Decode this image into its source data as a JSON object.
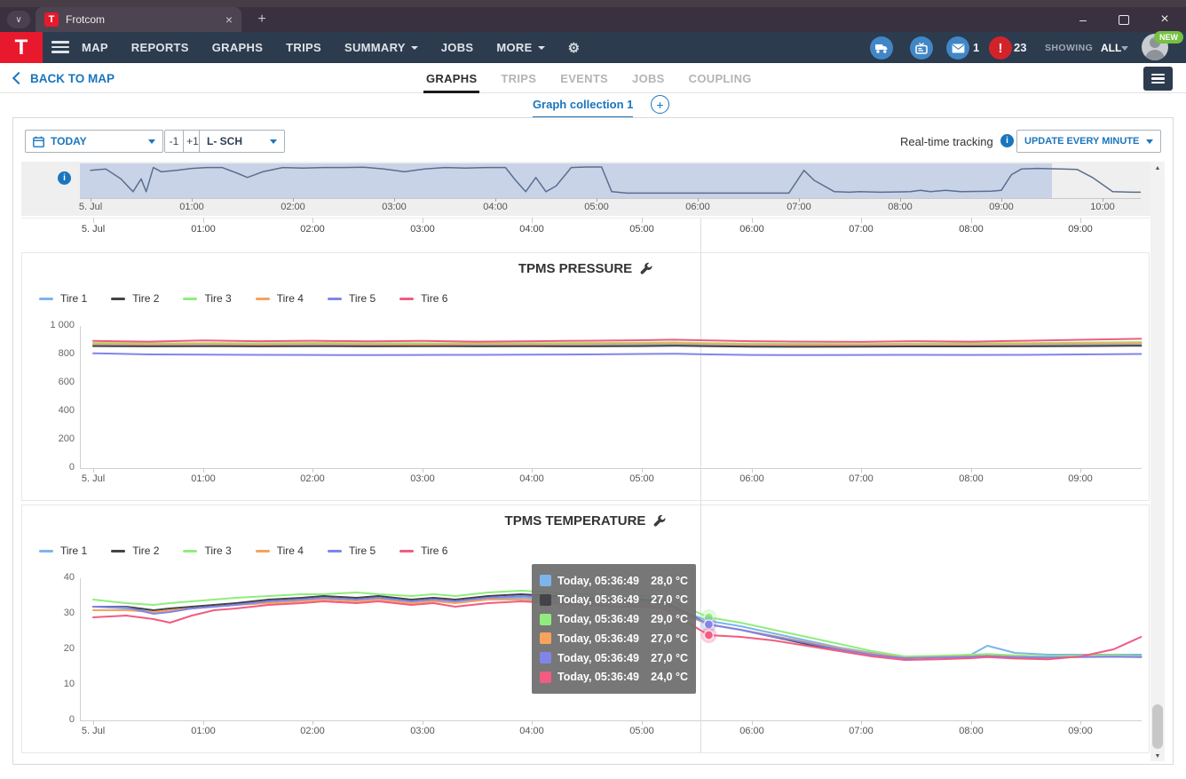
{
  "browser": {
    "tab_title": "Frotcom",
    "brand_letter": "T"
  },
  "navbar": {
    "items": [
      {
        "label": "MAP",
        "caret": false
      },
      {
        "label": "REPORTS",
        "caret": false
      },
      {
        "label": "GRAPHS",
        "caret": false
      },
      {
        "label": "TRIPS",
        "caret": false
      },
      {
        "label": "SUMMARY",
        "caret": true
      },
      {
        "label": "JOBS",
        "caret": false
      },
      {
        "label": "MORE",
        "caret": true
      }
    ],
    "mail_count": "1",
    "alert_count": "23",
    "showing_label": "SHOWING",
    "showing_value": "ALL",
    "new_badge": "NEW"
  },
  "subnav": {
    "back_label": "BACK TO MAP",
    "tabs": [
      {
        "label": "GRAPHS",
        "active": true
      },
      {
        "label": "TRIPS",
        "active": false
      },
      {
        "label": "EVENTS",
        "active": false
      },
      {
        "label": "JOBS",
        "active": false
      },
      {
        "label": "COUPLING",
        "active": false
      }
    ]
  },
  "collection": {
    "tab_label": "Graph collection 1"
  },
  "filters": {
    "date_range": "TODAY",
    "prev_label": "-1",
    "next_label": "+1",
    "vehicle": "L- SCH",
    "realtime_label": "Real-time tracking",
    "update_mode": "UPDATE EVERY MINUTE"
  },
  "icons": {
    "tab_search": "chevron-down",
    "favicon": "frotcom-logo",
    "nav_left": "hamburger",
    "nav_right": [
      "delivery-truck",
      "tv",
      "envelope",
      "exclamation-alert"
    ],
    "settings": "gear",
    "date": "calendar",
    "chart_settings": "wrench",
    "overview": "info",
    "collection_add": "plus",
    "panel_right": "list"
  },
  "colors": {
    "accent_blue": "#1b75bc",
    "brand_red": "#e8192c",
    "navbar_bg": "#2d3b4e",
    "icon_blue": "#4187c7",
    "alert_red": "#d2232a",
    "new_green": "#76c043",
    "series_palette": [
      "#7cb5ec",
      "#434348",
      "#90ed7d",
      "#f7a35c",
      "#8085e9",
      "#f15c80"
    ]
  },
  "chart_data": [
    {
      "type": "area",
      "name": "activity-overview-navigator",
      "x_unit": "hours since midnight, 5. Jul",
      "xlim": [
        -0.1,
        10.45
      ],
      "selection": [
        0,
        9.5
      ],
      "line_color": "#5b6e8e",
      "selection_color": "rgba(125,155,215,0.33)",
      "x_labels": [
        {
          "t": 0,
          "label": "5. Jul"
        },
        {
          "t": 1,
          "label": "01:00"
        },
        {
          "t": 2,
          "label": "02:00"
        },
        {
          "t": 3,
          "label": "03:00"
        },
        {
          "t": 4,
          "label": "04:00"
        },
        {
          "t": 5,
          "label": "05:00"
        },
        {
          "t": 6,
          "label": "06:00"
        },
        {
          "t": 7,
          "label": "07:00"
        },
        {
          "t": 8,
          "label": "08:00"
        },
        {
          "t": 9,
          "label": "09:00"
        },
        {
          "t": 10,
          "label": "10:00"
        }
      ],
      "points": [
        [
          0,
          0.85
        ],
        [
          0.15,
          0.9
        ],
        [
          0.3,
          0.55
        ],
        [
          0.42,
          0.1
        ],
        [
          0.5,
          0.55
        ],
        [
          0.55,
          0.1
        ],
        [
          0.62,
          0.95
        ],
        [
          0.7,
          0.8
        ],
        [
          0.85,
          0.85
        ],
        [
          1.0,
          0.92
        ],
        [
          1.15,
          0.95
        ],
        [
          1.3,
          0.95
        ],
        [
          1.45,
          0.75
        ],
        [
          1.55,
          0.6
        ],
        [
          1.7,
          0.8
        ],
        [
          1.9,
          0.95
        ],
        [
          2.1,
          0.93
        ],
        [
          2.3,
          0.95
        ],
        [
          2.5,
          0.95
        ],
        [
          2.7,
          0.96
        ],
        [
          2.9,
          0.9
        ],
        [
          3.0,
          0.85
        ],
        [
          3.1,
          0.8
        ],
        [
          3.3,
          0.9
        ],
        [
          3.5,
          0.95
        ],
        [
          3.7,
          0.93
        ],
        [
          3.9,
          0.95
        ],
        [
          4.1,
          0.95
        ],
        [
          4.2,
          0.5
        ],
        [
          4.3,
          0.1
        ],
        [
          4.4,
          0.6
        ],
        [
          4.5,
          0.1
        ],
        [
          4.6,
          0.3
        ],
        [
          4.75,
          0.95
        ],
        [
          4.9,
          0.97
        ],
        [
          5.05,
          0.97
        ],
        [
          5.15,
          0.1
        ],
        [
          5.3,
          0.05
        ],
        [
          6.0,
          0.05
        ],
        [
          6.9,
          0.05
        ],
        [
          7.05,
          0.85
        ],
        [
          7.15,
          0.5
        ],
        [
          7.35,
          0.1
        ],
        [
          7.5,
          0.08
        ],
        [
          7.6,
          0.1
        ],
        [
          7.8,
          0.08
        ],
        [
          8.1,
          0.1
        ],
        [
          8.2,
          0.15
        ],
        [
          8.3,
          0.1
        ],
        [
          8.45,
          0.15
        ],
        [
          8.6,
          0.1
        ],
        [
          8.9,
          0.12
        ],
        [
          9.0,
          0.15
        ],
        [
          9.1,
          0.7
        ],
        [
          9.2,
          0.9
        ],
        [
          9.35,
          0.92
        ],
        [
          9.6,
          0.9
        ],
        [
          9.75,
          0.88
        ],
        [
          9.9,
          0.6
        ],
        [
          10.1,
          0.1
        ],
        [
          10.3,
          0.08
        ],
        [
          10.45,
          0.08
        ]
      ]
    },
    {
      "type": "line",
      "title": "TPMS PRESSURE",
      "ylim": [
        0,
        1000
      ],
      "yticks": [
        {
          "v": 0,
          "label": "0"
        },
        {
          "v": 200,
          "label": "200"
        },
        {
          "v": 400,
          "label": "400"
        },
        {
          "v": 600,
          "label": "600"
        },
        {
          "v": 800,
          "label": "800"
        },
        {
          "v": 1000,
          "label": "1 000"
        }
      ],
      "x_labels": [
        {
          "t": 0,
          "label": "5. Jul"
        },
        {
          "t": 1,
          "label": "01:00"
        },
        {
          "t": 2,
          "label": "02:00"
        },
        {
          "t": 3,
          "label": "03:00"
        },
        {
          "t": 4,
          "label": "04:00"
        },
        {
          "t": 5,
          "label": "05:00"
        },
        {
          "t": 6,
          "label": "06:00"
        },
        {
          "t": 7,
          "label": "07:00"
        },
        {
          "t": 8,
          "label": "08:00"
        },
        {
          "t": 9,
          "label": "09:00"
        }
      ],
      "x": [
        0,
        0.5,
        1,
        1.5,
        2,
        2.5,
        3,
        3.5,
        4,
        4.5,
        5,
        5.3,
        5.61,
        6,
        6.5,
        7,
        7.5,
        8,
        8.5,
        9,
        9.55
      ],
      "series": [
        {
          "name": "Tire 1",
          "color": "#7cb5ec",
          "values": [
            868,
            864,
            866,
            865,
            867,
            864,
            866,
            865,
            864,
            866,
            868,
            870,
            866,
            862,
            861,
            862,
            863,
            864,
            865,
            868,
            872
          ]
        },
        {
          "name": "Tire 2",
          "color": "#434348",
          "values": [
            859,
            857,
            858,
            857,
            858,
            857,
            858,
            857,
            858,
            857,
            859,
            861,
            858,
            855,
            854,
            855,
            856,
            856,
            857,
            859,
            861
          ]
        },
        {
          "name": "Tire 3",
          "color": "#90ed7d",
          "values": [
            882,
            878,
            880,
            879,
            881,
            880,
            879,
            878,
            880,
            881,
            883,
            885,
            880,
            876,
            875,
            874,
            876,
            878,
            880,
            884,
            887
          ]
        },
        {
          "name": "Tire 4",
          "color": "#f7a35c",
          "values": [
            874,
            872,
            874,
            871,
            873,
            872,
            871,
            873,
            872,
            874,
            876,
            878,
            874,
            870,
            869,
            870,
            871,
            872,
            873,
            876,
            879
          ]
        },
        {
          "name": "Tire 5",
          "color": "#8085e9",
          "values": [
            808,
            800,
            798,
            797,
            796,
            795,
            796,
            797,
            798,
            800,
            803,
            805,
            800,
            796,
            795,
            796,
            797,
            796,
            797,
            800,
            803
          ]
        },
        {
          "name": "Tire 6",
          "color": "#f15c80",
          "values": [
            895,
            890,
            898,
            893,
            896,
            892,
            895,
            890,
            893,
            896,
            900,
            904,
            898,
            893,
            890,
            888,
            893,
            890,
            896,
            903,
            910
          ]
        }
      ]
    },
    {
      "type": "line",
      "title": "TPMS TEMPERATURE",
      "ylim": [
        0,
        40
      ],
      "yticks": [
        {
          "v": 0,
          "label": "0"
        },
        {
          "v": 10,
          "label": "10"
        },
        {
          "v": 20,
          "label": "20"
        },
        {
          "v": 30,
          "label": "30"
        },
        {
          "v": 40,
          "label": "40"
        }
      ],
      "x_labels": [
        {
          "t": 0,
          "label": "5. Jul"
        },
        {
          "t": 1,
          "label": "01:00"
        },
        {
          "t": 2,
          "label": "02:00"
        },
        {
          "t": 3,
          "label": "03:00"
        },
        {
          "t": 4,
          "label": "04:00"
        },
        {
          "t": 5,
          "label": "05:00"
        },
        {
          "t": 6,
          "label": "06:00"
        },
        {
          "t": 7,
          "label": "07:00"
        },
        {
          "t": 8,
          "label": "08:00"
        },
        {
          "t": 9,
          "label": "09:00"
        }
      ],
      "x": [
        0,
        0.3,
        0.55,
        0.7,
        0.9,
        1.1,
        1.3,
        1.6,
        1.9,
        2.1,
        2.4,
        2.6,
        2.9,
        3.1,
        3.3,
        3.6,
        3.9,
        4.2,
        4.5,
        4.8,
        5.0,
        5.2,
        5.61,
        5.9,
        6.2,
        6.5,
        6.8,
        7.1,
        7.4,
        7.7,
        8.0,
        8.15,
        8.4,
        8.7,
        9.0,
        9.3,
        9.55
      ],
      "series": [
        {
          "name": "Tire 1",
          "color": "#7cb5ec",
          "values": [
            32,
            31.5,
            30.5,
            31,
            31.5,
            32,
            32.5,
            33.5,
            34,
            34.5,
            34,
            34.5,
            33.5,
            34,
            33.5,
            34.5,
            34.5,
            34,
            33.5,
            33.5,
            33,
            32.5,
            28,
            26.5,
            24.5,
            22.5,
            20.5,
            19,
            17.5,
            18,
            18.5,
            21,
            19,
            18.5,
            18.5,
            18.5,
            18.5
          ]
        },
        {
          "name": "Tire 2",
          "color": "#434348",
          "values": [
            32,
            32,
            31,
            31.5,
            32,
            32.5,
            33,
            34,
            34.5,
            35,
            34.5,
            35,
            34,
            34.5,
            34,
            35,
            35.5,
            35,
            34.5,
            34,
            34,
            33.5,
            27,
            25.5,
            23.5,
            21.5,
            20,
            18.5,
            17.5,
            17.8,
            18,
            18.2,
            18,
            17.8,
            18,
            18.2,
            18
          ]
        },
        {
          "name": "Tire 3",
          "color": "#90ed7d",
          "values": [
            34,
            33,
            32.5,
            33,
            33.5,
            34,
            34.5,
            35,
            35.5,
            35.5,
            36,
            35.5,
            35,
            35.5,
            35,
            36,
            36.5,
            36,
            35.5,
            35,
            35,
            34.5,
            29,
            27.5,
            25.5,
            23.5,
            21.5,
            19.5,
            18,
            18.2,
            18.5,
            18.7,
            18.3,
            18,
            18.2,
            18.3,
            18
          ]
        },
        {
          "name": "Tire 4",
          "color": "#f7a35c",
          "values": [
            31,
            31,
            30.5,
            31,
            31.5,
            32,
            32.5,
            33,
            33.5,
            34,
            33.5,
            34,
            33,
            33.5,
            33,
            34,
            34,
            33.5,
            33,
            33,
            32.5,
            32,
            27,
            25.5,
            23.8,
            22,
            20.3,
            18.8,
            17.6,
            17.8,
            18,
            18.2,
            17.9,
            17.7,
            17.9,
            18,
            17.8
          ]
        },
        {
          "name": "Tire 5",
          "color": "#8085e9",
          "values": [
            32,
            31.8,
            30,
            30.5,
            31.5,
            32,
            32.5,
            33.5,
            34,
            34.5,
            34,
            34.5,
            33.5,
            34,
            33.5,
            34.5,
            35,
            34.5,
            34,
            33.8,
            33.5,
            33,
            27,
            25.5,
            23.6,
            21.8,
            20,
            18.5,
            17.5,
            17.7,
            17.9,
            18.1,
            17.8,
            17.7,
            17.8,
            17.9,
            17.8
          ]
        },
        {
          "name": "Tire 6",
          "color": "#f15c80",
          "values": [
            29,
            29.5,
            28.5,
            27.5,
            29.5,
            31,
            31.5,
            32.5,
            33,
            33.5,
            33,
            33.5,
            32.5,
            33,
            32,
            33,
            33.5,
            33,
            32.5,
            32,
            32,
            31.5,
            24,
            23.5,
            22.5,
            21,
            19.5,
            18,
            17,
            17.2,
            17.5,
            17.8,
            17.4,
            17.2,
            18,
            20,
            23.5
          ]
        }
      ],
      "crosshair_t": 5.53,
      "markers": [
        {
          "series": "Tire 3",
          "color": "#90ed7d",
          "t": 5.61,
          "v": 29
        },
        {
          "series": "Tire 5",
          "color": "#8085e9",
          "t": 5.61,
          "v": 27
        },
        {
          "series": "Tire 6",
          "color": "#f15c80",
          "t": 5.61,
          "v": 24
        }
      ],
      "tooltip": {
        "rows": [
          {
            "series": "Tire 1",
            "color": "#7cb5ec",
            "time": "Today, 05:36:49",
            "value": "28,0 °C"
          },
          {
            "series": "Tire 2",
            "color": "#434348",
            "time": "Today, 05:36:49",
            "value": "27,0 °C"
          },
          {
            "series": "Tire 3",
            "color": "#90ed7d",
            "time": "Today, 05:36:49",
            "value": "29,0 °C"
          },
          {
            "series": "Tire 4",
            "color": "#f7a35c",
            "time": "Today, 05:36:49",
            "value": "27,0 °C"
          },
          {
            "series": "Tire 5",
            "color": "#8085e9",
            "time": "Today, 05:36:49",
            "value": "27,0 °C"
          },
          {
            "series": "Tire 6",
            "color": "#f15c80",
            "time": "Today, 05:36:49",
            "value": "24,0 °C"
          }
        ]
      }
    }
  ]
}
